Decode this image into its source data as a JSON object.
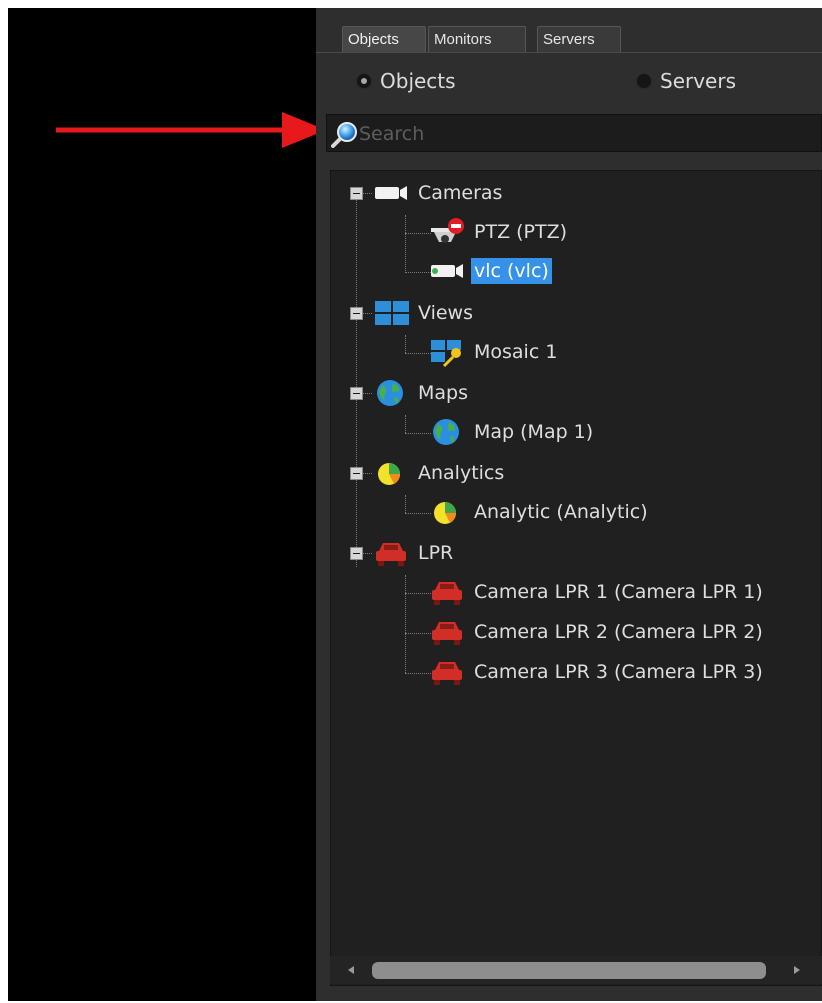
{
  "tabs": [
    "Objects",
    "Monitors",
    "Servers"
  ],
  "radios": [
    {
      "label": "Objects",
      "checked": true
    },
    {
      "label": "Servers",
      "checked": false
    }
  ],
  "search": {
    "placeholder": "Search",
    "value": ""
  },
  "tree": {
    "cameras": {
      "label": "Cameras",
      "icon": "camera-icon"
    },
    "ptz": {
      "label": "PTZ (PTZ)",
      "icon": "ptz-camera-icon"
    },
    "vlc": {
      "label": "vlc (vlc)",
      "icon": "camera-icon",
      "selected": true
    },
    "views": {
      "label": "Views",
      "icon": "views-grid-icon"
    },
    "mosaic": {
      "label": "Mosaic 1",
      "icon": "mosaic-key-icon"
    },
    "maps": {
      "label": "Maps",
      "icon": "globe-icon"
    },
    "map1": {
      "label": "Map (Map 1)",
      "icon": "globe-icon"
    },
    "analytics": {
      "label": "Analytics",
      "icon": "pie-chart-icon"
    },
    "analytic": {
      "label": "Analytic (Analytic)",
      "icon": "pie-chart-icon"
    },
    "lpr": {
      "label": "LPR",
      "icon": "car-icon"
    },
    "lpr1": {
      "label": "Camera LPR 1 (Camera LPR 1)",
      "icon": "car-icon"
    },
    "lpr2": {
      "label": "Camera LPR 2 (Camera LPR 2)",
      "icon": "car-icon"
    },
    "lpr3": {
      "label": "Camera LPR 3 (Camera LPR 3)",
      "icon": "car-icon"
    }
  },
  "colors": {
    "selection": "#3592e8",
    "arrow": "#e8191b",
    "panel": "#2e2e2e",
    "tree_background": "#202020"
  }
}
